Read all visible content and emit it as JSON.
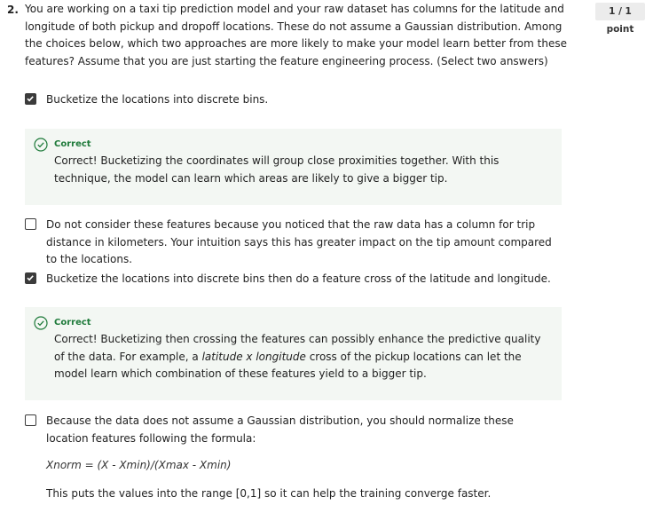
{
  "question": {
    "number": "2.",
    "points": "1 / 1 point",
    "prompt": "You are working on a taxi tip prediction model and your raw dataset has columns for the latitude and longitude of both pickup and dropoff locations. These do not assume a Gaussian distribution. Among the choices below, which two approaches are more likely to make your model learn better from these features? Assume that you are just starting the feature engineering process. (Select two answers)"
  },
  "options": [
    {
      "label": "Bucketize the locations into discrete bins.",
      "checked": true,
      "feedback": {
        "status": "Correct",
        "text": "Correct! Bucketizing the coordinates will group close proximities together. With this technique, the model can learn which areas are likely to give a bigger tip."
      }
    },
    {
      "label": "Do not consider these features because you noticed that the raw data has a column for trip distance in kilometers. Your intuition says this has greater impact on the tip amount compared to the locations.",
      "checked": false
    },
    {
      "label": "Bucketize the locations into discrete bins then do a feature cross of the latitude and longitude.",
      "checked": true,
      "feedback": {
        "status": "Correct",
        "text_before": "Correct! Bucketizing then crossing the features can possibly enhance the predictive quality of the data. For example, a ",
        "text_emphasis": "latitude x longitude",
        "text_after": " cross of the pickup locations can let the model learn which combination of these features yield to a bigger tip."
      }
    },
    {
      "label": "Because the data does not assume a Gaussian distribution, you should normalize these location features following the formula:",
      "checked": false,
      "formula": "Xnorm = (X - Xmin)/(Xmax - Xmin)",
      "note": "This puts the values into the range [0,1] so it can help the training converge faster."
    }
  ],
  "colors": {
    "correct_green": "#1e7a3a",
    "feedback_bg": "#f3f7f3",
    "checkbox": "#3b3b3b"
  }
}
